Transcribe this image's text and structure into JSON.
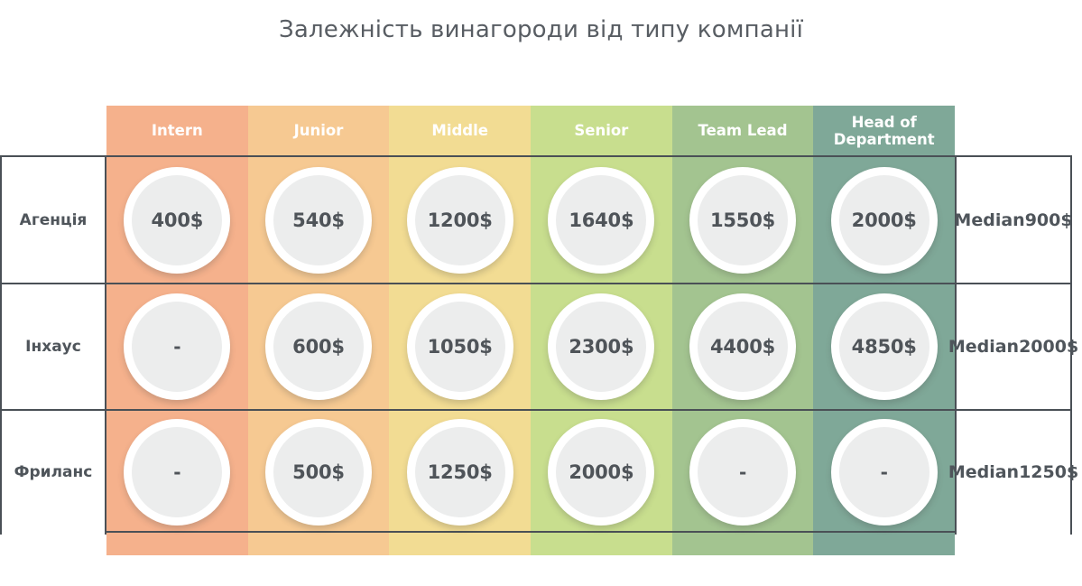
{
  "title": "Залежність винагороди від типу компанії",
  "columns": [
    {
      "label": "Intern",
      "color": "#F5B18C"
    },
    {
      "label": "Junior",
      "color": "#F6C992"
    },
    {
      "label": "Middle",
      "color": "#F2DC93"
    },
    {
      "label": "Senior",
      "color": "#C8DE8E"
    },
    {
      "label": "Team Lead",
      "color": "#A3C490"
    },
    {
      "label": "Head of Department",
      "color": "#7FA898"
    }
  ],
  "median_label": "Median",
  "rows": [
    {
      "label": "Агенція",
      "values": [
        "400$",
        "540$",
        "1200$",
        "1640$",
        "1550$",
        "2000$"
      ],
      "median": "900$"
    },
    {
      "label": "Інхаус",
      "values": [
        "-",
        "600$",
        "1050$",
        "2300$",
        "4400$",
        "4850$"
      ],
      "median": "2000$"
    },
    {
      "label": "Фриланс",
      "values": [
        "-",
        "500$",
        "1250$",
        "2000$",
        "-",
        "-"
      ],
      "median": "1250$"
    }
  ],
  "chart_data": {
    "type": "table",
    "title": "Залежність винагороди від типу компанії",
    "xlabel": "",
    "ylabel": "",
    "categories": [
      "Intern",
      "Junior",
      "Middle",
      "Senior",
      "Team Lead",
      "Head of Department"
    ],
    "series": [
      {
        "name": "Агенція",
        "values": [
          400,
          540,
          1200,
          1640,
          1550,
          2000
        ],
        "median": 900
      },
      {
        "name": "Інхаус",
        "values": [
          null,
          600,
          1050,
          2300,
          4400,
          4850
        ],
        "median": 2000
      },
      {
        "name": "Фриланс",
        "values": [
          null,
          500,
          1250,
          2000,
          null,
          null
        ],
        "median": 1250
      }
    ],
    "units": "USD",
    "missing_marker": "-",
    "legend": "none",
    "grid": true
  }
}
